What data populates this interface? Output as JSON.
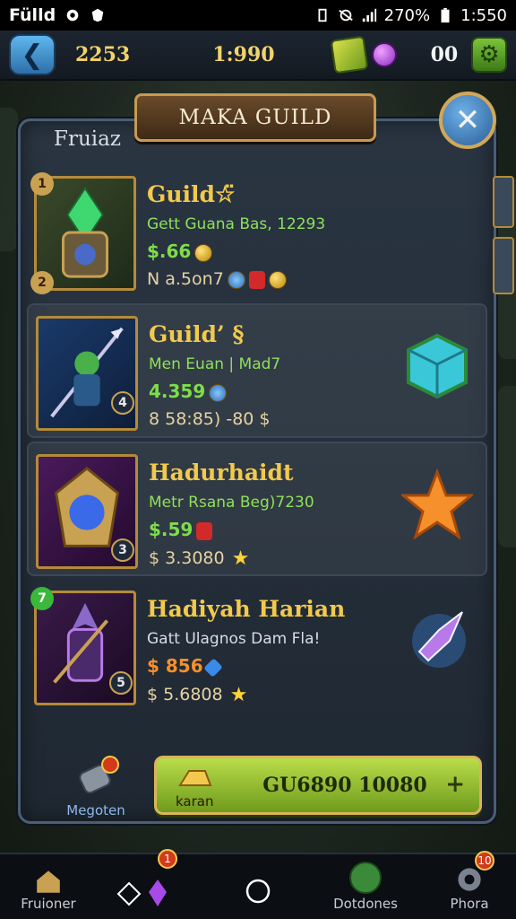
{
  "status_bar": {
    "app_name": "Fülld",
    "battery": "270%",
    "time": "1:550"
  },
  "top_bar": {
    "currency_a": "2253",
    "currency_b": "1:990",
    "currency_c": "00"
  },
  "panel": {
    "title": "MAKA GUILD",
    "label": "Fruiaz",
    "items": [
      {
        "name": "Guild☆̈",
        "sub": "Gett Guana Bas, 12293",
        "price": "$.66",
        "stats": "N a.5on7",
        "loot": "none"
      },
      {
        "name": "Guild’ §",
        "sub": "Men Euan | Mad7",
        "price": "4.359",
        "stats": "8 58:85) -80 $",
        "loot": "blue-cube"
      },
      {
        "name": "Hadurhaidt",
        "sub": "Metr Rsana Beg)7230",
        "price": "$.59",
        "stats": "$ 3.3080",
        "loot": "orange-star"
      },
      {
        "name": "Hadiyah Harian",
        "sub": "Gatt Ulagnos Dam Fla!",
        "price": "$ 856",
        "stats": "$ 5.6808",
        "loot": "purple-crystal"
      }
    ]
  },
  "footer": {
    "mag_label": "Megoten",
    "buy_label": "GU6890 10080",
    "buy_sub": "karan"
  },
  "nav": [
    {
      "label": "Fruioner",
      "icon": "house-icon"
    },
    {
      "label": "",
      "icon": "diamond-icon",
      "badge": "1"
    },
    {
      "label": "",
      "icon": "circle-home-icon"
    },
    {
      "label": "Dotdones",
      "icon": "globe-icon"
    },
    {
      "label": "Phora",
      "icon": "gear-icon",
      "badge": "10"
    }
  ],
  "colors": {
    "accent_gold": "#f2c94c",
    "accent_green": "#7edd4a",
    "panel_bg": "#2a3542"
  }
}
